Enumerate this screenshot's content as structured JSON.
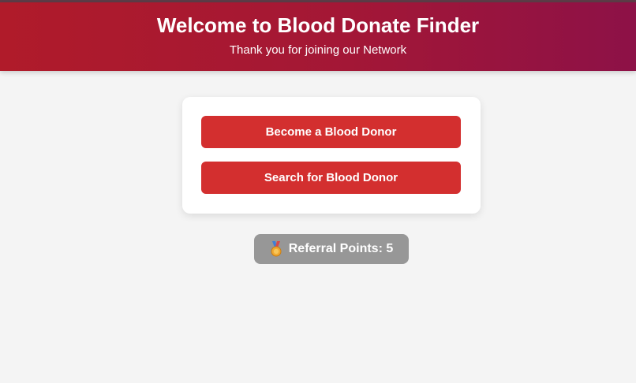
{
  "header": {
    "title": "Welcome to Blood Donate Finder",
    "subtitle": "Thank you for joining our Network"
  },
  "actions": {
    "become_donor_label": "Become a Blood Donor",
    "search_donor_label": "Search for Blood Donor"
  },
  "referral": {
    "icon": "medal-icon",
    "label": "Referral Points: 5"
  },
  "colors": {
    "header_gradient_start": "#b01b2a",
    "header_gradient_end": "#8d1147",
    "button": "#d32f2f",
    "referral_badge": "#979797",
    "page_background": "#f4f4f4"
  }
}
